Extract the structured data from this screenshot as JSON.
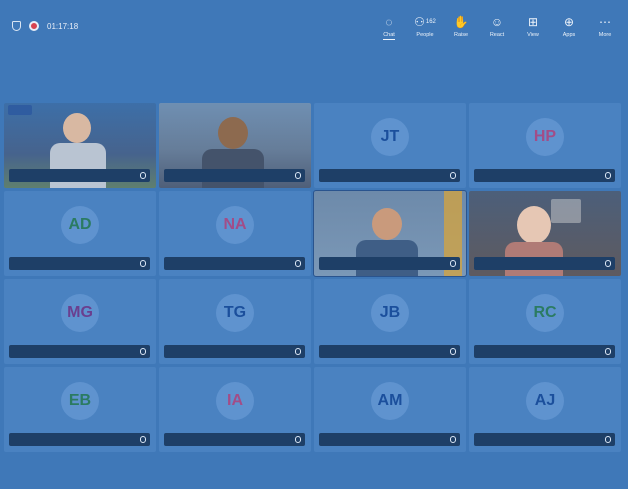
{
  "meeting": {
    "timer": "01:17:18"
  },
  "toolbar": {
    "chat": {
      "label": "Chat",
      "icon": "chat-icon"
    },
    "people": {
      "label": "People",
      "count": "162",
      "icon": "people-icon"
    },
    "raise": {
      "label": "Raise",
      "icon": "raise-hand-icon"
    },
    "react": {
      "label": "React",
      "icon": "smile-icon"
    },
    "view": {
      "label": "View",
      "icon": "grid-icon"
    },
    "apps": {
      "label": "Apps",
      "icon": "apps-icon"
    },
    "more": {
      "label": "More",
      "icon": "more-icon"
    }
  },
  "participants": [
    {
      "name": "",
      "video": true,
      "initials": ""
    },
    {
      "name": "",
      "video": true,
      "initials": ""
    },
    {
      "name": "",
      "video": false,
      "initials": "JT"
    },
    {
      "name": "",
      "video": false,
      "initials": "HP"
    },
    {
      "name": "",
      "video": false,
      "initials": "AD"
    },
    {
      "name": "",
      "video": false,
      "initials": "NA"
    },
    {
      "name": "",
      "video": true,
      "initials": ""
    },
    {
      "name": "",
      "video": true,
      "initials": ""
    },
    {
      "name": "",
      "video": false,
      "initials": "MG"
    },
    {
      "name": "",
      "video": false,
      "initials": "TG"
    },
    {
      "name": "",
      "video": false,
      "initials": "JB"
    },
    {
      "name": "",
      "video": false,
      "initials": "RC"
    },
    {
      "name": "",
      "video": false,
      "initials": "EB"
    },
    {
      "name": "",
      "video": false,
      "initials": "IA"
    },
    {
      "name": "",
      "video": false,
      "initials": "AM"
    },
    {
      "name": "",
      "video": false,
      "initials": "AJ"
    }
  ],
  "colors": {
    "background": "#3f78b8",
    "tile": "#4a82c1",
    "avatar": "#5f93cf",
    "name_tag": "#1e3f67",
    "initials_blue": "#1b4f9c",
    "initials_green": "#2b7b62",
    "initials_purple": "#6a3f8f",
    "initials_pink": "#a24d88"
  }
}
